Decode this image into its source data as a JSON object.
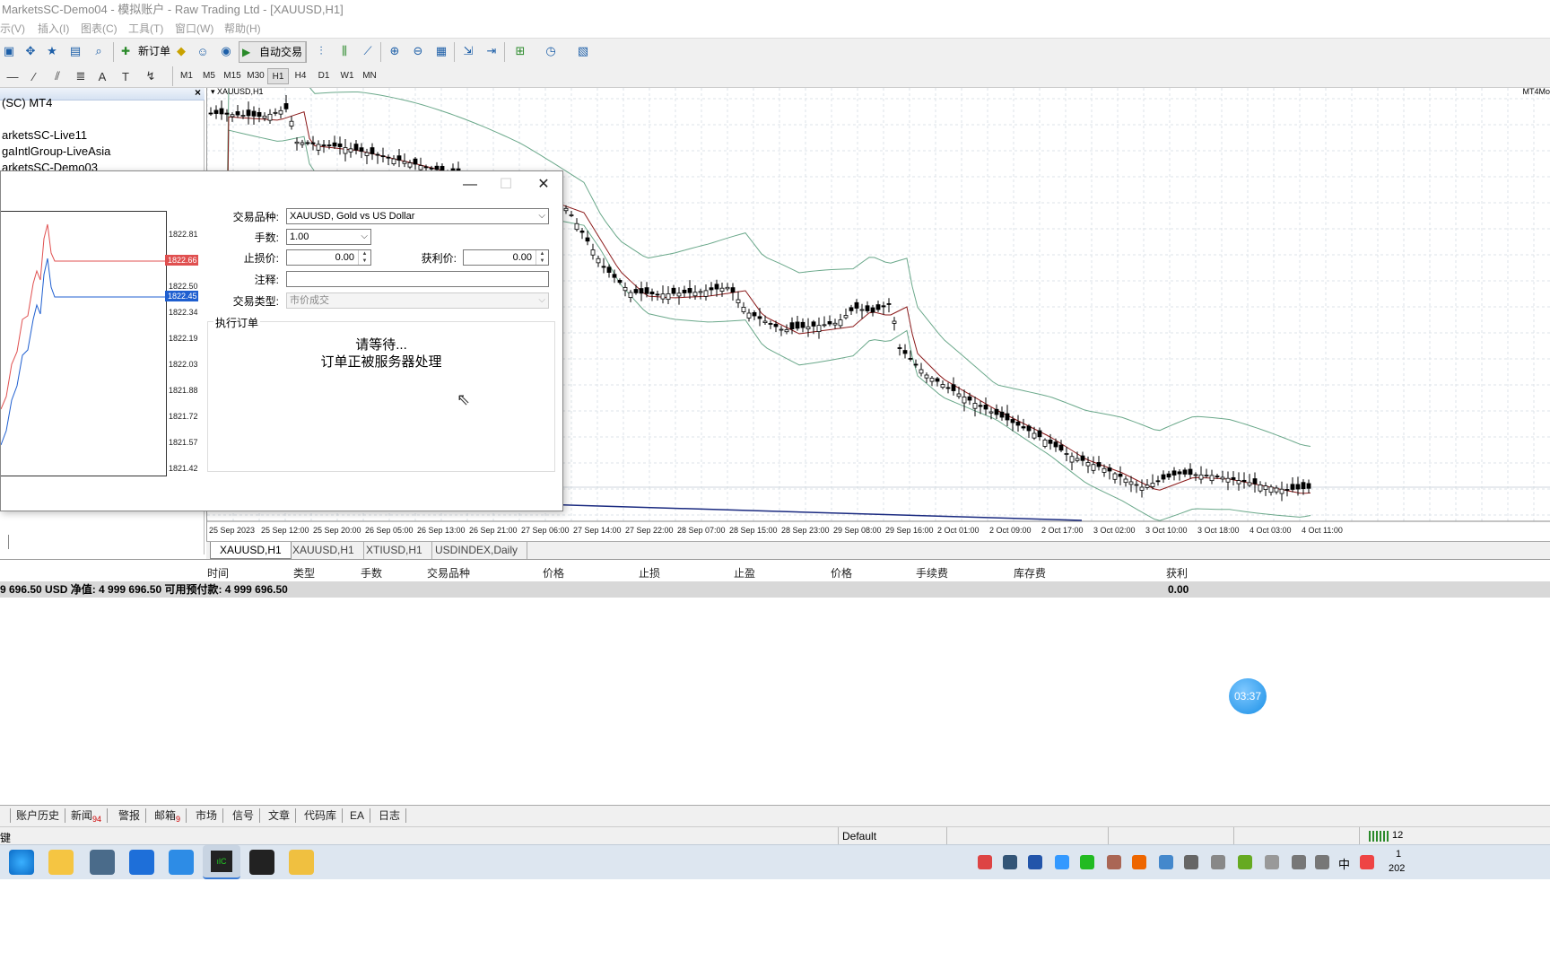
{
  "window_title": "MarketsSC-Demo04 - 模拟账户 - Raw Trading Ltd - [XAUUSD,H1]",
  "menu": [
    "示(V)",
    "插入(I)",
    "图表(C)",
    "工具(T)",
    "窗口(W)",
    "帮助(H)"
  ],
  "toolbar": {
    "new_order": "新订单",
    "auto_trading": "自动交易"
  },
  "timeframes": [
    "M1",
    "M5",
    "M15",
    "M30",
    "H1",
    "H4",
    "D1",
    "W1",
    "MN"
  ],
  "active_timeframe": "H1",
  "navigator": {
    "items": [
      "(SC) MT4",
      "arketsSC-Live11",
      "gaIntlGroup-LiveAsia",
      "arketsSC-Demo03"
    ]
  },
  "chart": {
    "title": "XAUUSD,H1",
    "right_label": "MT4Mo",
    "x_labels": [
      "25 Sep 2023",
      "25 Sep 12:00",
      "25 Sep 20:00",
      "26 Sep 05:00",
      "26 Sep 13:00",
      "26 Sep 21:00",
      "27 Sep 06:00",
      "27 Sep 14:00",
      "27 Sep 22:00",
      "28 Sep 07:00",
      "28 Sep 15:00",
      "28 Sep 23:00",
      "29 Sep 08:00",
      "29 Sep 16:00",
      "2 Oct 01:00",
      "2 Oct 09:00",
      "2 Oct 17:00",
      "3 Oct 02:00",
      "3 Oct 10:00",
      "3 Oct 18:00",
      "4 Oct 03:00",
      "4 Oct 11:00"
    ]
  },
  "chart_tabs": [
    "XAUUSD,H1",
    "XAUUSD,H1",
    "XTIUSD,H1",
    "USDINDEX,Daily"
  ],
  "order_dialog": {
    "symbol_label": "交易品种:",
    "symbol_value": "XAUUSD, Gold vs US Dollar",
    "volume_label": "手数:",
    "volume_value": "1.00",
    "sl_label": "止损价:",
    "sl_value": "0.00",
    "tp_label": "获利价:",
    "tp_value": "0.00",
    "comment_label": "注释:",
    "comment_value": "",
    "type_label": "交易类型:",
    "type_value": "市价成交",
    "exec_legend": "执行订单",
    "wait_line1": "请等待...",
    "wait_line2": "订单正被服务器处理",
    "tick_prices": [
      "1822.81",
      "1822.66",
      "1822.50",
      "1822.45",
      "1822.34",
      "1822.19",
      "1822.03",
      "1821.88",
      "1821.72",
      "1821.57",
      "1821.42"
    ],
    "ask_price": "1822.66",
    "bid_price": "1822.45",
    "ask_color": "#e05050",
    "bid_color": "#1f5fd0"
  },
  "terminal": {
    "headers": [
      "时间",
      "类型",
      "手数",
      "交易品种",
      "价格",
      "止损",
      "止盈",
      "价格",
      "手续费",
      "库存费",
      "获利"
    ],
    "balance_line": "9 696.50 USD  净值: 4 999 696.50  可用预付款: 4 999 696.50",
    "profit_total": "0.00",
    "tabs": [
      "账户历史",
      "新闻",
      "警报",
      "邮箱",
      "市场",
      "信号",
      "文章",
      "代码库",
      "EA",
      "日志"
    ],
    "news_count": "94",
    "mail_count": "9"
  },
  "status": {
    "left": "键",
    "profile": "Default",
    "right": "12"
  },
  "timer": "03:37",
  "taskbar": {
    "clock_top": "1",
    "clock_bottom": "202",
    "ime": "中"
  }
}
